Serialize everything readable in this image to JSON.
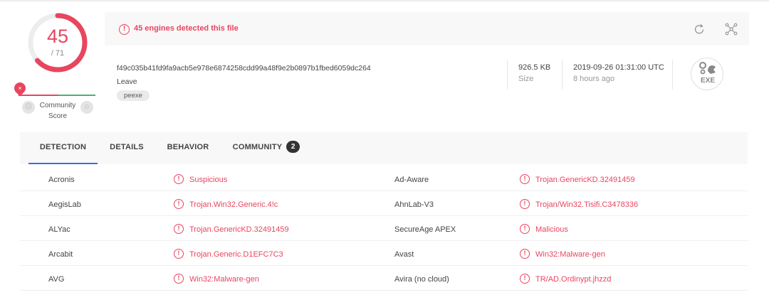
{
  "score": {
    "detected": "45",
    "total": "/ 71",
    "fraction": 0.634
  },
  "community": {
    "label": "Community Score",
    "line1": "Community",
    "line2": "Score",
    "pin_glyph": "×"
  },
  "banner": {
    "message": "45 engines detected this file",
    "alert_glyph": "!"
  },
  "file": {
    "hash": "f49c035b41fd9fa9acb5e978e6874258cdd99a48f9e2b0897b1fbed6059dc264",
    "name": "Leave",
    "tags": [
      "peexe"
    ],
    "size": "926.5 KB",
    "size_label": "Size",
    "date": "2019-09-26 01:31:00 UTC",
    "date_ago": "8 hours ago",
    "type_icon": "exe-icon",
    "type_label": "EXE"
  },
  "tabs": [
    {
      "label": "DETECTION",
      "active": true
    },
    {
      "label": "DETAILS",
      "active": false
    },
    {
      "label": "BEHAVIOR",
      "active": false
    },
    {
      "label": "COMMUNITY",
      "active": false,
      "badge": "2"
    }
  ],
  "detections": [
    {
      "left_engine": "Acronis",
      "left_result": "Suspicious",
      "right_engine": "Ad-Aware",
      "right_result": "Trojan.GenericKD.32491459"
    },
    {
      "left_engine": "AegisLab",
      "left_result": "Trojan.Win32.Generic.4!c",
      "right_engine": "AhnLab-V3",
      "right_result": "Trojan/Win32.Tisifi.C3478336"
    },
    {
      "left_engine": "ALYac",
      "left_result": "Trojan.GenericKD.32491459",
      "right_engine": "SecureAge APEX",
      "right_result": "Malicious"
    },
    {
      "left_engine": "Arcabit",
      "left_result": "Trojan.Generic.D1EFC7C3",
      "right_engine": "Avast",
      "right_result": "Win32:Malware-gen"
    },
    {
      "left_engine": "AVG",
      "left_result": "Win32:Malware-gen",
      "right_engine": "Avira (no cloud)",
      "right_result": "TR/AD.Ordinypt.jhzzd"
    }
  ],
  "colors": {
    "danger": "#e8455f",
    "safe": "#4caf73",
    "accent": "#3a6fd8"
  }
}
